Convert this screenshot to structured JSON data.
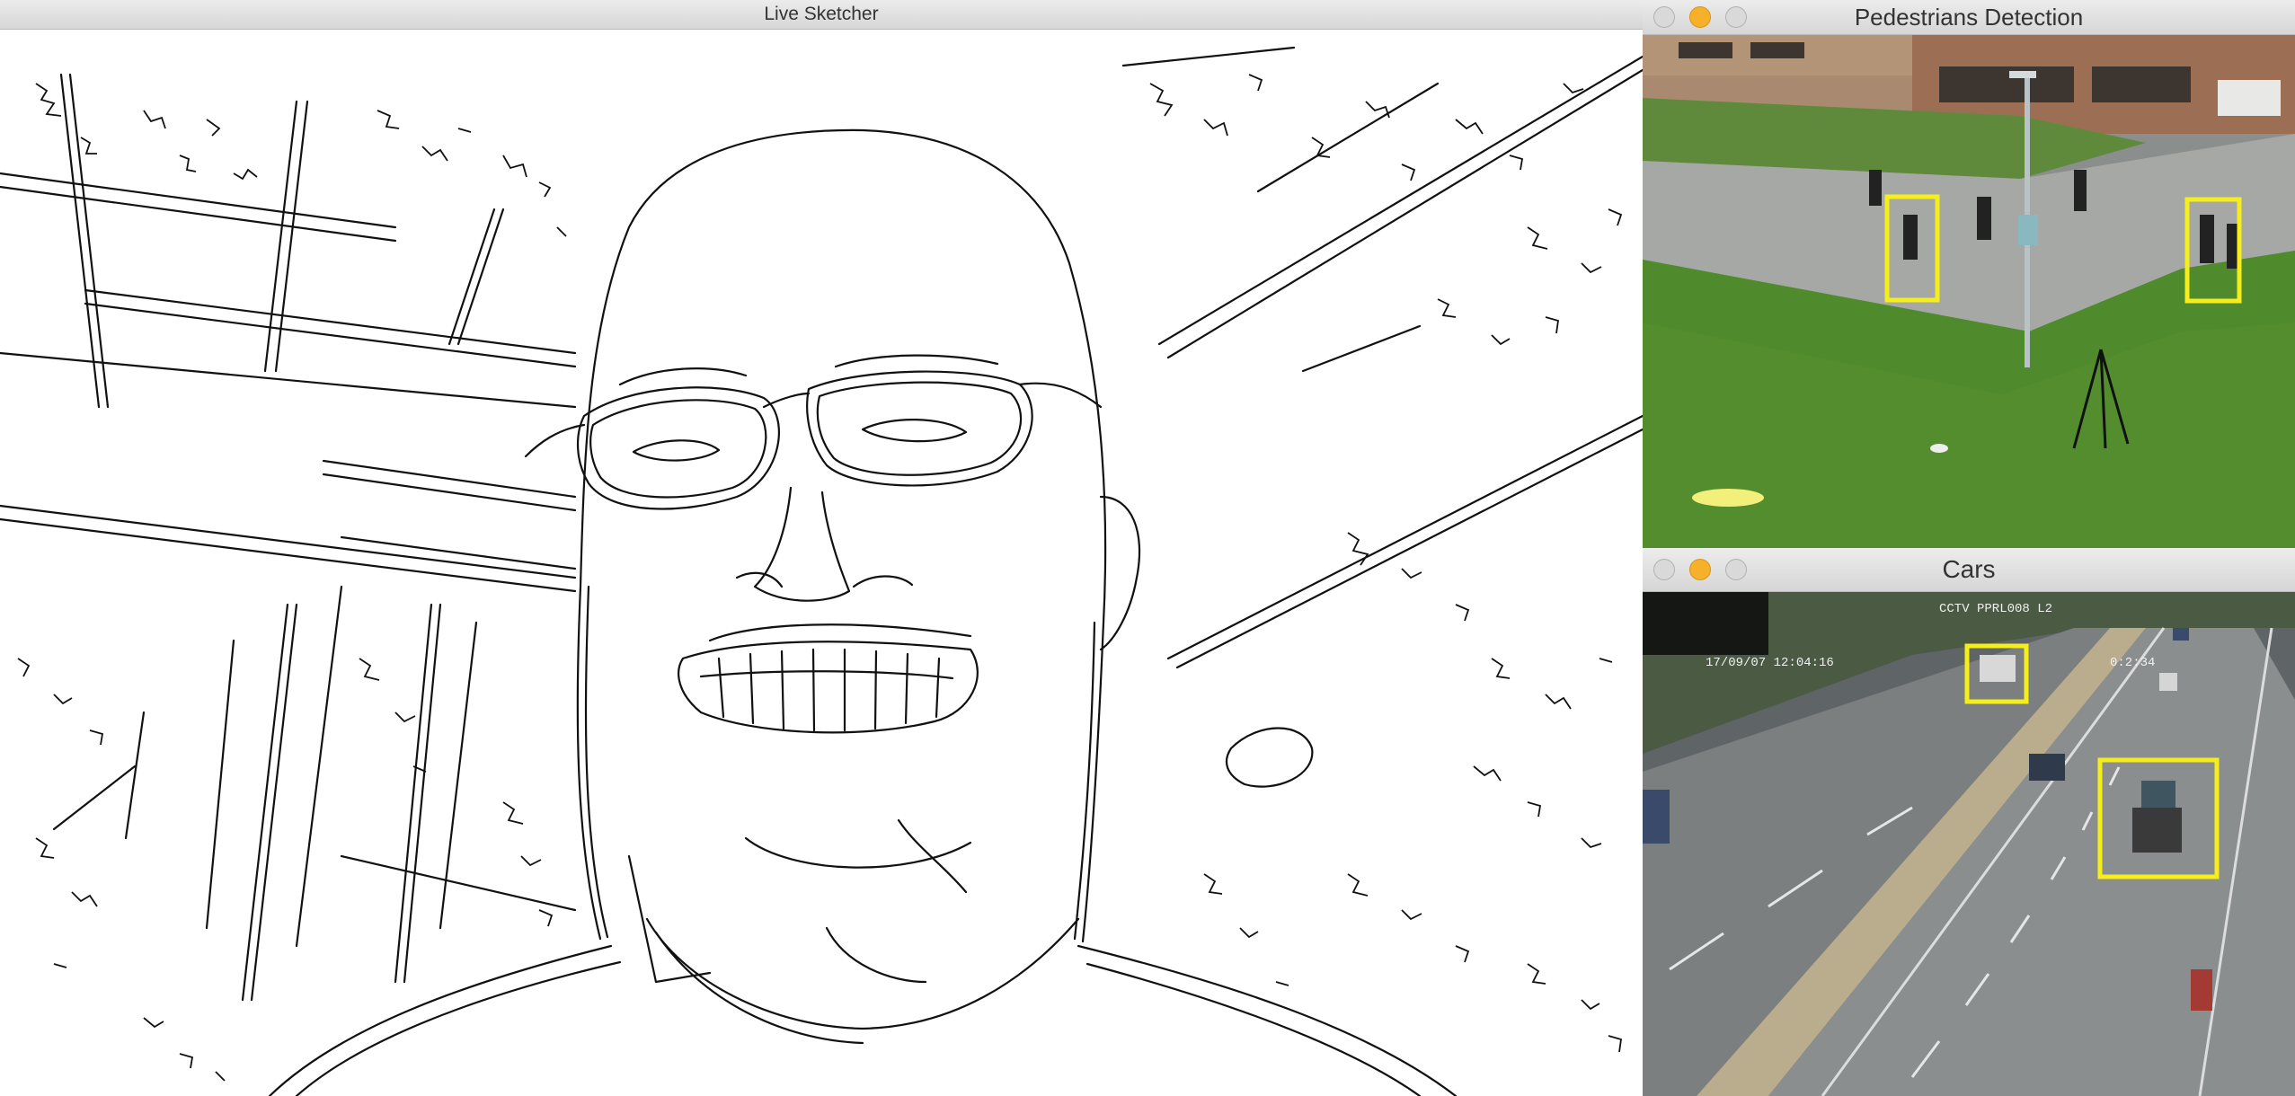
{
  "windows": {
    "sketch": {
      "title": "Live Sketcher"
    },
    "pedestrians": {
      "title": "Pedestrians Detection",
      "detections": 2
    },
    "cars": {
      "title": "Cars",
      "detections": 2,
      "overlay": {
        "camera_id": "CCTV  PPRL008 L2",
        "timestamp": "17/09/07 12:04:16",
        "corner_code": "0:2:34"
      }
    }
  },
  "colors": {
    "detection_box": "#f5ee1a",
    "sketch_line": "#111111",
    "minimize_light": "#f6b02a"
  }
}
